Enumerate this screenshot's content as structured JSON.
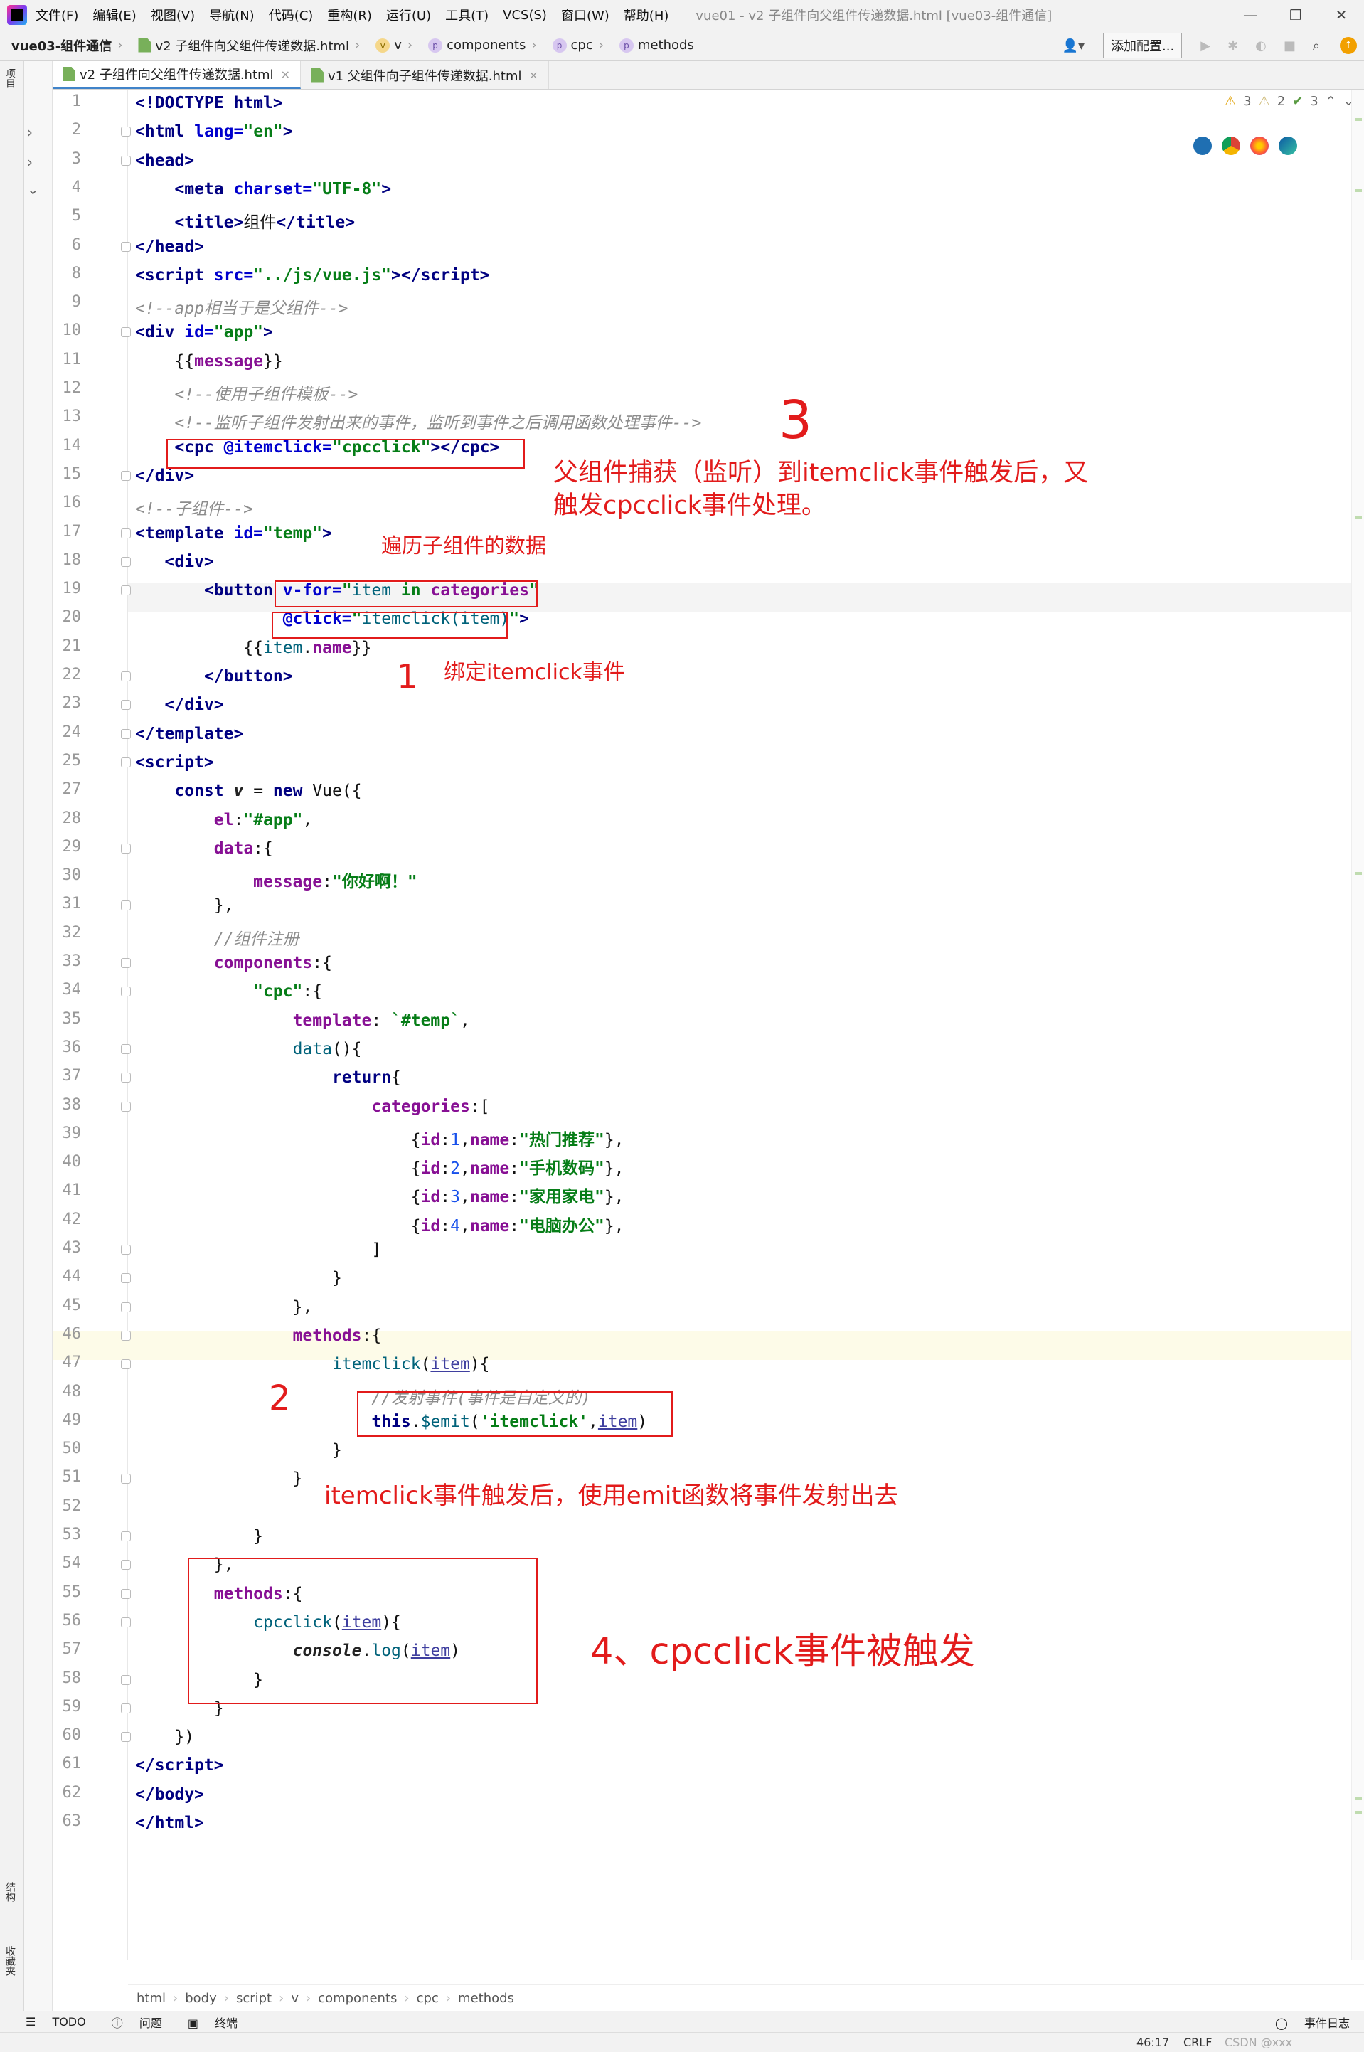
{
  "menubar": {
    "items": [
      "文件(F)",
      "编辑(E)",
      "视图(V)",
      "导航(N)",
      "代码(C)",
      "重构(R)",
      "运行(U)",
      "工具(T)",
      "VCS(S)",
      "窗口(W)",
      "帮助(H)"
    ],
    "title": "vue01 - v2 子组件向父组件传递数据.html [vue03-组件通信]"
  },
  "navbar": {
    "project": "vue03-组件通信",
    "file": "v2 子组件向父组件传递数据.html",
    "crumbs": [
      "v",
      "components",
      "cpc",
      "methods"
    ],
    "add_config": "添加配置..."
  },
  "tabs": [
    "v2 子组件向父组件传递数据.html",
    "v1 父组件向子组件传递数据.html"
  ],
  "left_tools": {
    "project": "项目",
    "structure": "结构",
    "favorites": "收藏夹"
  },
  "inspections": {
    "warn1": "3",
    "warn2": "2",
    "ok": "3"
  },
  "code_lines": [
    {
      "n": "1",
      "html": "<span class=\"tg\">&lt;!DOCTYPE html&gt;</span>"
    },
    {
      "n": "2",
      "html": "<span class=\"tg\">&lt;html </span><span class=\"at\">lang=</span><span class=\"st\">\"en\"</span><span class=\"tg\">&gt;</span>"
    },
    {
      "n": "3",
      "html": "<span class=\"tg\">&lt;head&gt;</span>"
    },
    {
      "n": "4",
      "html": "    <span class=\"tg\">&lt;meta </span><span class=\"at\">charset=</span><span class=\"st\">\"UTF-8\"</span><span class=\"tg\">&gt;</span>"
    },
    {
      "n": "5",
      "html": "    <span class=\"tg\">&lt;title&gt;</span>组件<span class=\"tg\">&lt;/title&gt;</span>"
    },
    {
      "n": "6",
      "html": "<span class=\"tg\">&lt;/head&gt;</span>"
    },
    {
      "n": "8",
      "html": "<span class=\"tg\">&lt;script </span><span class=\"at\">src=</span><span class=\"st\">\"../js/vue.js\"</span><span class=\"tg\">&gt;&lt;/script&gt;</span>"
    },
    {
      "n": "9",
      "html": "<span class=\"cm\">&lt;!--app相当于是父组件--&gt;</span>"
    },
    {
      "n": "10",
      "html": "<span class=\"tg\">&lt;div </span><span class=\"at\">id=</span><span class=\"st\">\"app\"</span><span class=\"tg\">&gt;</span>"
    },
    {
      "n": "11",
      "html": "    {{<span class=\"pr\">message</span>}}"
    },
    {
      "n": "12",
      "html": "    <span class=\"cm\">&lt;!--使用子组件模板--&gt;</span>"
    },
    {
      "n": "13",
      "html": "    <span class=\"cm\">&lt;!--监听子组件发射出来的事件，监听到事件之后调用函数处理事件--&gt;</span>"
    },
    {
      "n": "14",
      "html": "    <span class=\"tg\">&lt;cpc </span><span class=\"at\">@itemclick=</span><span class=\"st\">\"cpcclick\"</span><span class=\"tg\">&gt;&lt;/cpc&gt;</span>"
    },
    {
      "n": "15",
      "html": "<span class=\"tg\">&lt;/div&gt;</span>"
    },
    {
      "n": "16",
      "html": "<span class=\"cm\">&lt;!--子组件--&gt;</span>"
    },
    {
      "n": "17",
      "html": "<span class=\"tg\">&lt;template </span><span class=\"at\">id=</span><span class=\"st\">\"temp\"</span><span class=\"tg\">&gt;</span>"
    },
    {
      "n": "18",
      "html": "   <span class=\"tg\">&lt;div&gt;</span>"
    },
    {
      "n": "19",
      "html": "       <span class=\"tg\">&lt;button </span><span class=\"at\">v-for=</span><span class=\"st\">\"</span><span class=\"fn\">item</span><span class=\"st\"> in </span><span class=\"pr\">categories</span><span class=\"st\">\"</span>"
    },
    {
      "n": "20",
      "html": "               <span class=\"at\">@click=</span><span class=\"st\">\"</span><span class=\"fn\">itemclick(item)</span><span class=\"st\">\"</span><span class=\"tg\">&gt;</span>"
    },
    {
      "n": "21",
      "html": "           {{<span class=\"fn\">item</span>.<span class=\"pr\">name</span>}}"
    },
    {
      "n": "22",
      "html": "       <span class=\"tg\">&lt;/button&gt;</span>"
    },
    {
      "n": "23",
      "html": "   <span class=\"tg\">&lt;/div&gt;</span>"
    },
    {
      "n": "24",
      "html": "<span class=\"tg\">&lt;/template&gt;</span>"
    },
    {
      "n": "25",
      "html": "<span class=\"tg\">&lt;script&gt;</span>"
    },
    {
      "n": "27",
      "html": "    <span class=\"kw\">const</span> <span class=\"it\">v</span> = <span class=\"kw\">new</span> Vue({"
    },
    {
      "n": "28",
      "html": "        <span class=\"pr\">el</span>:<span class=\"st\">\"#app\"</span>,"
    },
    {
      "n": "29",
      "html": "        <span class=\"pr\">data</span>:{"
    },
    {
      "n": "30",
      "html": "            <span class=\"pr\">message</span>:<span class=\"st\">\"你好啊！\"</span>"
    },
    {
      "n": "31",
      "html": "        },"
    },
    {
      "n": "32",
      "html": "        <span class=\"cm\">//组件注册</span>"
    },
    {
      "n": "33",
      "html": "        <span class=\"pr\">components</span>:{"
    },
    {
      "n": "34",
      "html": "            <span class=\"st\">\"cpc\"</span>:{"
    },
    {
      "n": "35",
      "html": "                <span class=\"pr\">template</span>: <span class=\"st\">`#temp`</span>,"
    },
    {
      "n": "36",
      "html": "                <span class=\"fn\">data</span>(){"
    },
    {
      "n": "37",
      "html": "                    <span class=\"kw\">return</span>{"
    },
    {
      "n": "38",
      "html": "                        <span class=\"pr\">categories</span>:["
    },
    {
      "n": "39",
      "html": "                            {<span class=\"pr\">id</span>:<span class=\"nu\">1</span>,<span class=\"pr\">name</span>:<span class=\"st\">\"热门推荐\"</span>},"
    },
    {
      "n": "40",
      "html": "                            {<span class=\"pr\">id</span>:<span class=\"nu\">2</span>,<span class=\"pr\">name</span>:<span class=\"st\">\"手机数码\"</span>},"
    },
    {
      "n": "41",
      "html": "                            {<span class=\"pr\">id</span>:<span class=\"nu\">3</span>,<span class=\"pr\">name</span>:<span class=\"st\">\"家用家电\"</span>},"
    },
    {
      "n": "42",
      "html": "                            {<span class=\"pr\">id</span>:<span class=\"nu\">4</span>,<span class=\"pr\">name</span>:<span class=\"st\">\"电脑办公\"</span>},"
    },
    {
      "n": "43",
      "html": "                        ]"
    },
    {
      "n": "44",
      "html": "                    }"
    },
    {
      "n": "45",
      "html": "                },"
    },
    {
      "n": "46",
      "html": "                <span class=\"pr\">methods</span>:{"
    },
    {
      "n": "47",
      "html": "                    <span class=\"fn\">itemclick</span>(<span class=\"vr\">item</span>){"
    },
    {
      "n": "48",
      "html": "                        <span class=\"cm\">//发射事件(事件是自定义的)</span>"
    },
    {
      "n": "49",
      "html": "                        <span class=\"kw\">this</span>.<span class=\"fn\">$emit</span>(<span class=\"st\">'itemclick'</span>,<span class=\"vr\">item</span>)"
    },
    {
      "n": "50",
      "html": "                    }"
    },
    {
      "n": "51",
      "html": "                }"
    },
    {
      "n": "52",
      "html": ""
    },
    {
      "n": "53",
      "html": "            }"
    },
    {
      "n": "54",
      "html": "        },"
    },
    {
      "n": "55",
      "html": "        <span class=\"pr\">methods</span>:{"
    },
    {
      "n": "56",
      "html": "            <span class=\"fn\">cpcclick</span>(<span class=\"vr\">item</span>){"
    },
    {
      "n": "57",
      "html": "                <span class=\"it\">console</span>.<span class=\"fn\">log</span>(<span class=\"vr\">item</span>)"
    },
    {
      "n": "58",
      "html": "            }"
    },
    {
      "n": "59",
      "html": "        }"
    },
    {
      "n": "60",
      "html": "    })"
    },
    {
      "n": "61",
      "html": "<span class=\"tg\">&lt;/script&gt;</span>"
    },
    {
      "n": "62",
      "html": "<span class=\"tg\">&lt;/body&gt;</span>"
    },
    {
      "n": "63",
      "html": "<span class=\"tg\">&lt;/html&gt;</span>"
    }
  ],
  "annotations": {
    "num3": "3",
    "ann3a": "父组件捕获（监听）到itemclick事件触发后，又",
    "ann3b": "触发cpcclick事件处理。",
    "traverse": "遍历子组件的数据",
    "num1": "1",
    "bind": "绑定itemclick事件",
    "num2": "2",
    "emit": "itemclick事件触发后，使用emit函数将事件发射出去",
    "ann4": "4、cpcclick事件被触发"
  },
  "breadcrumb": [
    "html",
    "body",
    "script",
    "v",
    "components",
    "cpc",
    "methods"
  ],
  "bottom_tools": {
    "todo": "TODO",
    "problems": "问题",
    "terminal": "终端",
    "events": "事件日志"
  },
  "status": {
    "position": "46:17",
    "line_sep": "CRLF",
    "watermark": "CSDN @xxx"
  }
}
